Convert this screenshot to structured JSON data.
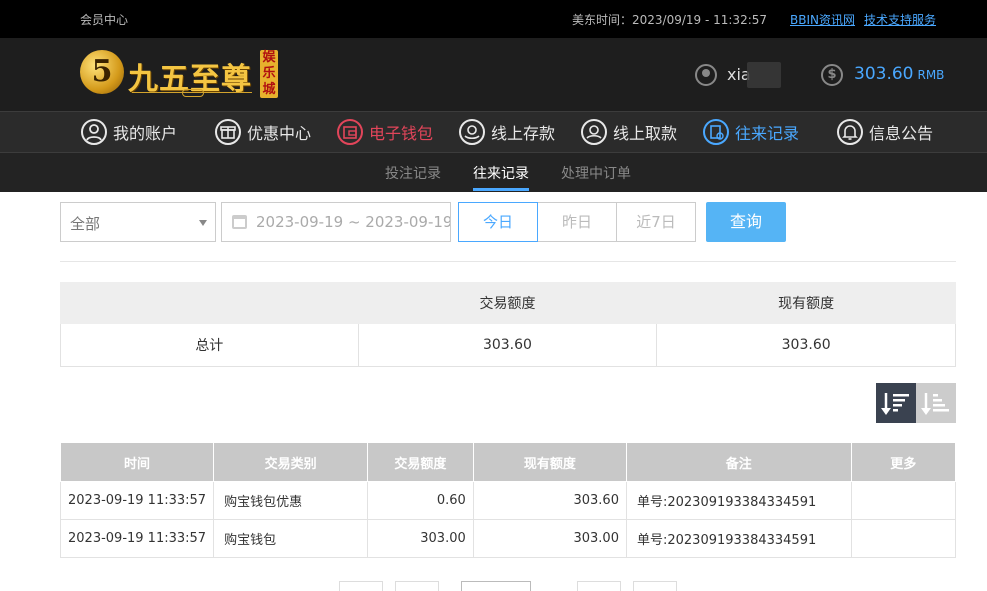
{
  "topbar": {
    "member_center": "会员中心",
    "time_label": "美东时间：2023/09/19 - 11:32:57",
    "link_bbin": "BBIN资讯网",
    "link_support": "技术支持服务"
  },
  "header": {
    "logo_text": "九五至尊",
    "logo_badge": "娱乐城",
    "logo_digit": "5",
    "username": "xia",
    "balance": "303.60",
    "balance_unit": "RMB"
  },
  "nav": [
    {
      "label": "我的账户",
      "icon": "user-icon"
    },
    {
      "label": "优惠中心",
      "icon": "gift-icon"
    },
    {
      "label": "电子钱包",
      "icon": "wallet-icon"
    },
    {
      "label": "线上存款",
      "icon": "deposit-icon"
    },
    {
      "label": "线上取款",
      "icon": "withdraw-icon"
    },
    {
      "label": "往来记录",
      "icon": "record-icon"
    },
    {
      "label": "信息公告",
      "icon": "bell-icon"
    }
  ],
  "subtabs": [
    "投注记录",
    "往来记录",
    "处理中订单"
  ],
  "filter": {
    "type_value": "全部",
    "date_range": "2023-09-19 ~ 2023-09-19",
    "today": "今日",
    "yesterday": "昨日",
    "last7": "近7日",
    "query": "查询"
  },
  "summary": {
    "headers": [
      "",
      "交易额度",
      "现有额度"
    ],
    "row": {
      "label": "总计",
      "amount": "303.60",
      "balance": "303.60"
    }
  },
  "records": {
    "headers": [
      "时间",
      "交易类别",
      "交易额度",
      "现有额度",
      "备注",
      "更多"
    ],
    "rows": [
      {
        "time": "2023-09-19 11:33:57",
        "type": "购宝钱包优惠",
        "amount": "0.60",
        "balance": "303.60",
        "note": "单号:202309193384334591",
        "more": ""
      },
      {
        "time": "2023-09-19 11:33:57",
        "type": "购宝钱包",
        "amount": "303.00",
        "balance": "303.00",
        "note": "单号:202309193384334591",
        "more": ""
      }
    ]
  },
  "colors": {
    "accent": "#4aa8ff",
    "wallet": "#e2455a",
    "query_btn": "#55b4f5"
  }
}
